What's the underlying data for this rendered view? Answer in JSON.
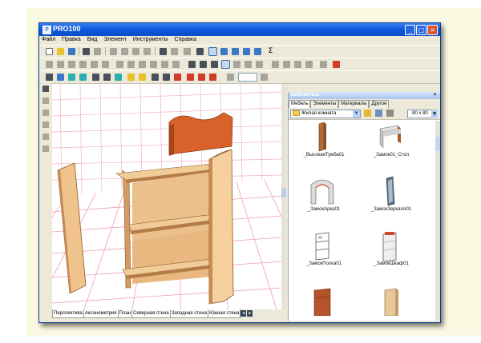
{
  "window": {
    "title": "PRO100",
    "minimize": "_",
    "maximize": "□",
    "close": "×"
  },
  "menu": [
    "Файл",
    "Правка",
    "Вид",
    "Элемент",
    "Инструменты",
    "Справка"
  ],
  "view_tabs": [
    "Перспектива",
    "Аксонометрия",
    "План",
    "Северная стена",
    "Западная стена",
    "Южная стена"
  ],
  "library": {
    "title": "Библиотека",
    "close": "×",
    "tabs": [
      "Мебель",
      "Элементы",
      "Материалы",
      "Другое"
    ],
    "active_tab": "Мебель",
    "folder": "Жилая комната",
    "size_value": "80 x 80",
    "items": [
      {
        "label": "_ВысокаяТумба01",
        "icon": "tall-cabinet-thumb"
      },
      {
        "label": "_Замок01_Стол",
        "icon": "table-thumb"
      },
      {
        "label": "_ЗамокАрка01",
        "icon": "arch-thumb"
      },
      {
        "label": "_ЗамокЗеркало01",
        "icon": "mirror-thumb"
      },
      {
        "label": "_ЗамокПолка01",
        "icon": "shelf-thumb"
      },
      {
        "label": "_ЗамокШкаф01",
        "icon": "wardrobe-thumb"
      },
      {
        "label": "",
        "icon": "dresser-thumb"
      },
      {
        "label": "",
        "icon": "cabinet-thumb"
      }
    ]
  },
  "colors": {
    "titlebar": "#0a56d9",
    "wood_light": "#f2c691",
    "wood_mid": "#e0aa73",
    "wood_dark": "#b07a47",
    "crest": "#d9622a",
    "grid": "#f19cb0"
  }
}
